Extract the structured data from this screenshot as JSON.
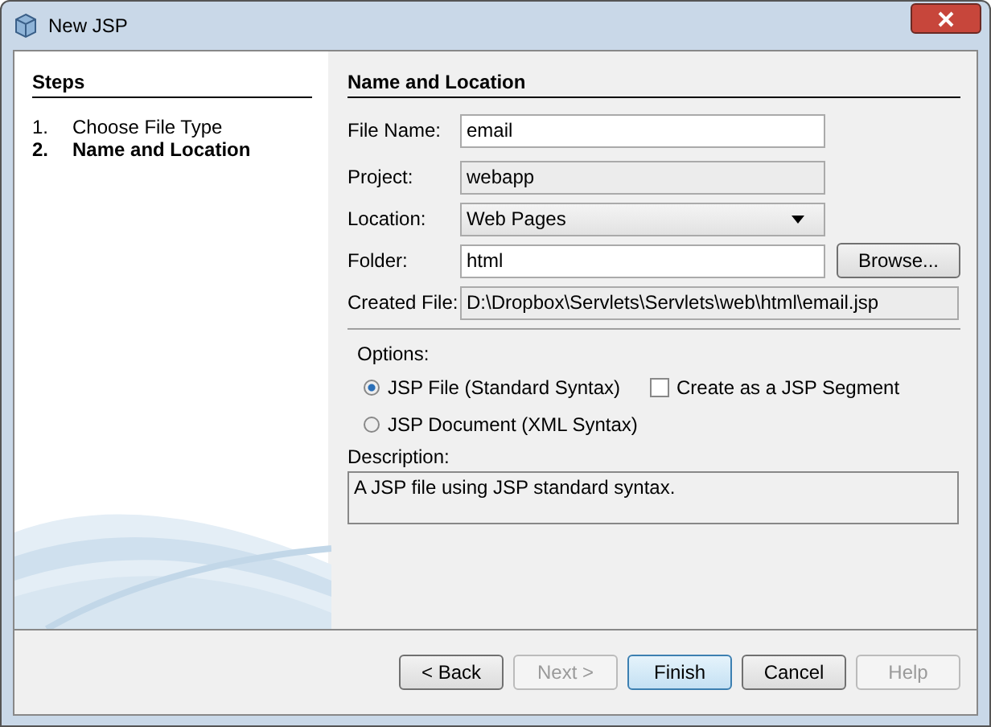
{
  "window": {
    "title": "New JSP"
  },
  "steps": {
    "title": "Steps",
    "items": [
      {
        "number": "1.",
        "label": "Choose File Type",
        "selected": false
      },
      {
        "number": "2.",
        "label": "Name and Location",
        "selected": true
      }
    ]
  },
  "panel": {
    "title": "Name and Location"
  },
  "fields": [
    {
      "kind": "input",
      "label": "File Name:",
      "value": "email"
    },
    {
      "kind": "readonly",
      "label": "Project:",
      "value": "webapp"
    },
    {
      "kind": "dropdown",
      "label": "Location:",
      "value": "Web Pages"
    },
    {
      "kind": "input",
      "label": "Folder:",
      "value": "html",
      "button": "Browse..."
    },
    {
      "kind": "readonly",
      "label": "Created File:",
      "value": "D:\\Dropbox\\Servlets\\Servlets\\web\\html\\email.jsp"
    }
  ],
  "options": {
    "label": "Options:",
    "radios": [
      {
        "label": "JSP File (Standard Syntax)",
        "selected": true
      },
      {
        "label": "JSP Document (XML Syntax)",
        "selected": false
      }
    ],
    "checkbox": {
      "label": "Create as a JSP Segment",
      "checked": false
    }
  },
  "description": {
    "label": "Description:",
    "text": "A JSP file using JSP standard syntax."
  },
  "buttons": [
    {
      "label": "< Back",
      "disabled": false,
      "default": false
    },
    {
      "label": "Next >",
      "disabled": true,
      "default": false
    },
    {
      "label": "Finish",
      "disabled": false,
      "default": true
    },
    {
      "label": "Cancel",
      "disabled": false,
      "default": false
    },
    {
      "label": "Help",
      "disabled": true,
      "default": false
    }
  ]
}
